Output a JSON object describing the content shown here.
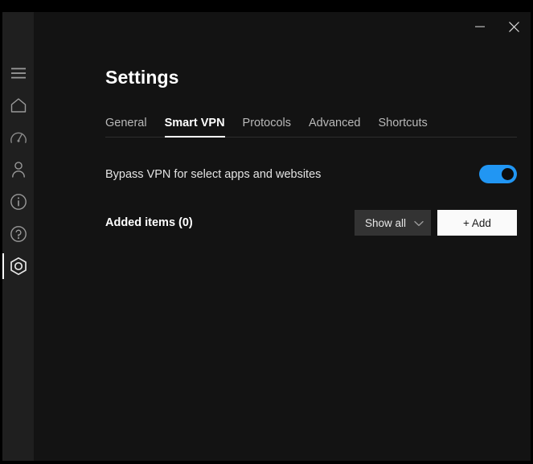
{
  "window": {
    "minimize_label": "Minimize",
    "close_label": "Close"
  },
  "sidebar": {
    "items": [
      {
        "icon": "hamburger-menu-icon",
        "name": "menu"
      },
      {
        "icon": "home-icon",
        "name": "home"
      },
      {
        "icon": "speedometer-icon",
        "name": "speed-test"
      },
      {
        "icon": "person-icon",
        "name": "account"
      },
      {
        "icon": "info-circle-icon",
        "name": "info"
      },
      {
        "icon": "help-circle-icon",
        "name": "help"
      },
      {
        "icon": "settings-hexagon-icon",
        "name": "settings",
        "active": true
      }
    ]
  },
  "header": {
    "title": "Settings"
  },
  "tabs": [
    {
      "label": "General",
      "active": false
    },
    {
      "label": "Smart VPN",
      "active": true
    },
    {
      "label": "Protocols",
      "active": false
    },
    {
      "label": "Advanced",
      "active": false
    },
    {
      "label": "Shortcuts",
      "active": false
    }
  ],
  "bypass": {
    "label": "Bypass VPN for select apps and websites",
    "toggle_state": "on"
  },
  "added_items": {
    "label": "Added items (0)",
    "count": 0,
    "filter_label": "Show all",
    "add_label": "+ Add"
  },
  "colors": {
    "accent_blue": "#2196f3",
    "window_background": "#131313",
    "sidebar_background": "#1f1f1f",
    "dropdown_background": "#333333",
    "add_button_background": "#fafafa"
  }
}
